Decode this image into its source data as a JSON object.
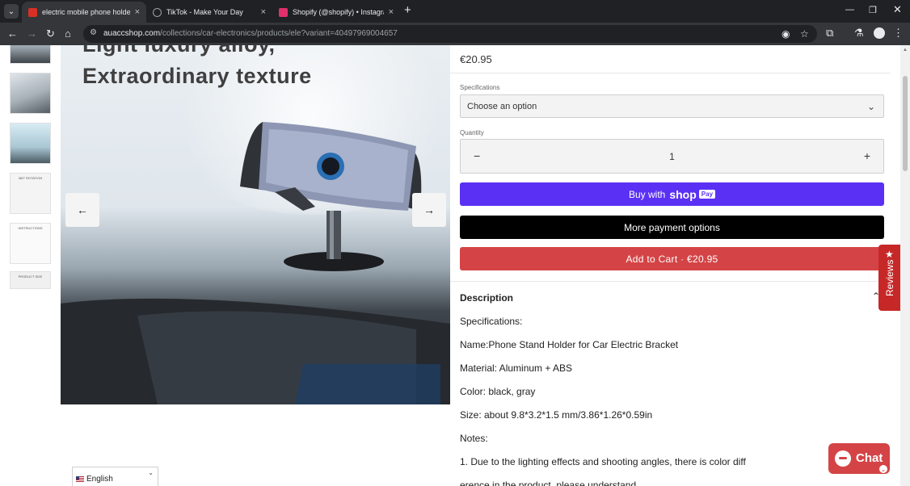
{
  "browser": {
    "tabs": [
      {
        "title": "electric mobile phone holder - /",
        "favicon_color": "#d93025",
        "active": true
      },
      {
        "title": "TikTok - Make Your Day",
        "favicon_color": "#202124",
        "active": false
      },
      {
        "title": "Shopify (@shopify) • Instagram",
        "favicon_color": "#e1306c",
        "active": false
      }
    ],
    "url_host": "auaccshop.com",
    "url_path": "/collections/car-electronics/products/ele?variant=40497969004657"
  },
  "gallery": {
    "headline_top": "Light luxury alloy,",
    "headline_bottom": "Extraordinary texture",
    "thumbs": [
      "",
      "",
      "",
      "360° ROTATION",
      "INSTRUCTIONS",
      "PRODUCT SIZE"
    ]
  },
  "language": {
    "label": "English"
  },
  "product": {
    "price": "€20.95",
    "spec_label": "Specifications",
    "spec_placeholder": "Choose an option",
    "qty_label": "Quantity",
    "qty_value": "1",
    "shop_pay_prefix": "Buy with",
    "shop_pay_brand": "shop",
    "shop_pay_badge": "Pay",
    "more_payment": "More payment options",
    "add_to_cart": "Add to Cart · €20.95",
    "description_title": "Description",
    "description_lines": [
      "Specifications:",
      "Name:Phone Stand Holder for Car Electric Bracket",
      "Material: Aluminum + ABS",
      "Color: black, gray",
      "Size: about 9.8*3.2*1.5 mm/3.86*1.26*0.59in",
      "Notes:",
      "1. Due to the lighting effects and shooting angles, there is color diff",
      "erence in the product, please understand."
    ]
  },
  "widgets": {
    "reviews_label": "Reviews",
    "chat_label": "Chat"
  },
  "colors": {
    "shop_pay": "#5a31f4",
    "cart": "#d44446",
    "reviews": "#c62828"
  }
}
